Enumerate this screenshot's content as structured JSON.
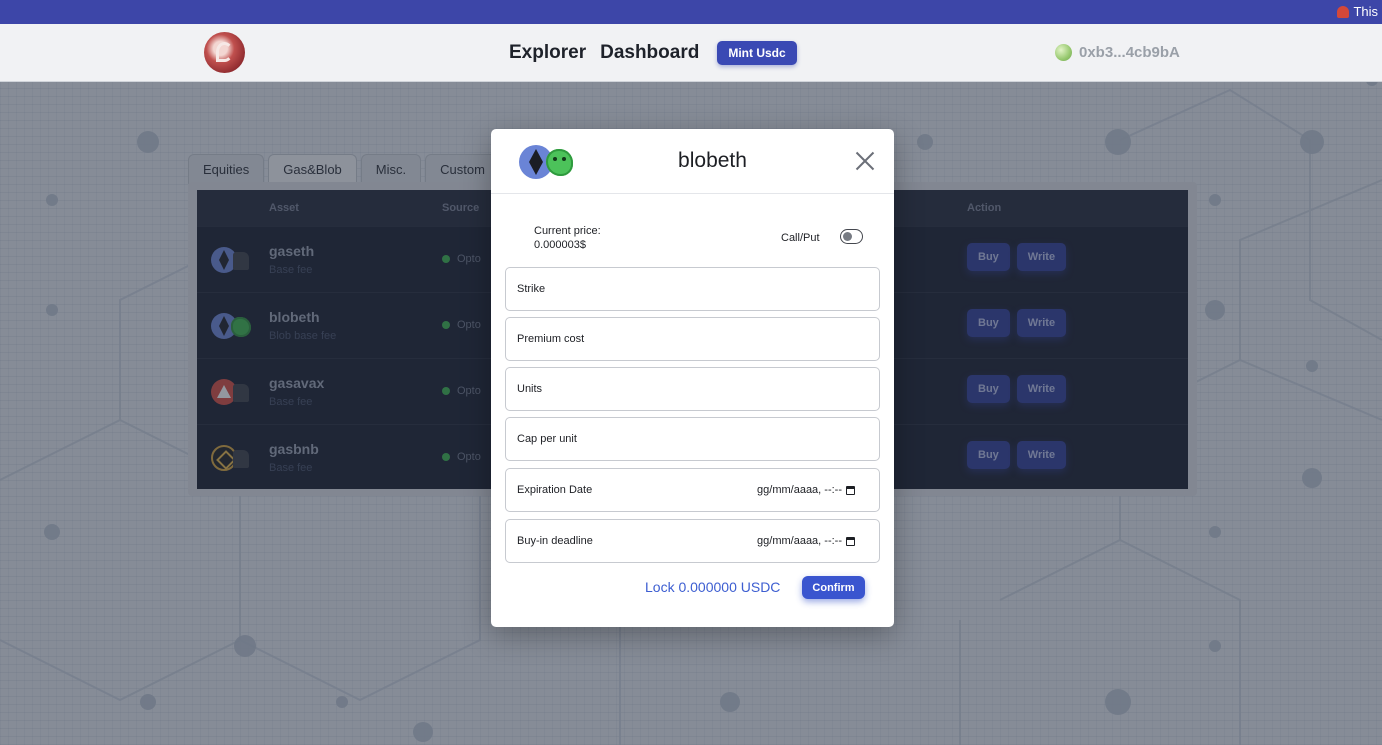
{
  "banner": {
    "note": "This"
  },
  "nav": {
    "links": [
      "Explorer",
      "Dashboard"
    ],
    "mint_label": "Mint Usdc",
    "wallet": "0xb3...4cb9bA"
  },
  "tabs": [
    "Equities",
    "Gas&Blob",
    "Misc.",
    "Custom"
  ],
  "active_tab": "Gas&Blob",
  "table": {
    "headers": {
      "asset": "Asset",
      "source": "Source",
      "action": "Action"
    },
    "rows": [
      {
        "name": "gaseth",
        "sub": "Base fee",
        "source": "Opto",
        "icon": "eth-gas-icon"
      },
      {
        "name": "blobeth",
        "sub": "Blob base fee",
        "source": "Opto",
        "icon": "eth-blob-icon"
      },
      {
        "name": "gasavax",
        "sub": "Base fee",
        "source": "Opto",
        "icon": "avax-gas-icon"
      },
      {
        "name": "gasbnb",
        "sub": "Base fee",
        "source": "Opto",
        "icon": "bnb-gas-icon"
      }
    ],
    "buy_label": "Buy",
    "write_label": "Write"
  },
  "modal": {
    "title": "blobeth",
    "price_label": "Current price:",
    "price_value": "0.000003$",
    "callput_label": "Call/Put",
    "fields": {
      "strike": "Strike",
      "premium": "Premium cost",
      "units": "Units",
      "cap": "Cap per unit",
      "expiration": "Expiration Date",
      "buyin": "Buy-in deadline"
    },
    "date_placeholder": "gg/mm/aaaa, --:--",
    "lock_text": "Lock 0.000000 USDC",
    "confirm_label": "Confirm"
  },
  "colors": {
    "banner": "#3d46a8",
    "accent": "#3a55cf",
    "table_bg": "#171c2c",
    "source_dot": "#38b34a"
  }
}
